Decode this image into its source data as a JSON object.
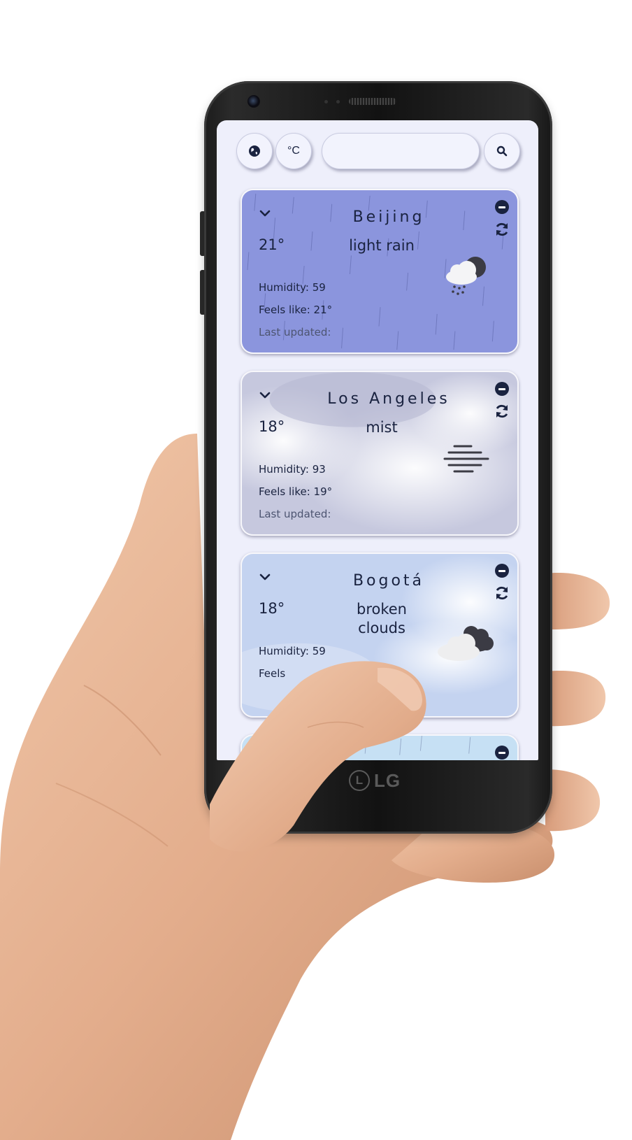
{
  "toolbar": {
    "location_button_label": "",
    "unit_button_label": "°C",
    "search_value": "",
    "search_placeholder": ""
  },
  "cards": [
    {
      "city": "Beijing",
      "temperature": "21°",
      "description": "light rain",
      "humidity": "Humidity: 59",
      "feels_like": "Feels like: 21°",
      "last_updated": "Last updated:",
      "icon": "rain-cloud-moon-icon",
      "background": "rain"
    },
    {
      "city": "Los Angeles",
      "temperature": "18°",
      "description": "mist",
      "humidity": "Humidity: 93",
      "feels_like": "Feels like: 19°",
      "last_updated": "Last updated:",
      "icon": "mist-icon",
      "background": "mist"
    },
    {
      "city": "Bogotá",
      "temperature": "18°",
      "description": "broken clouds",
      "description_lines": [
        "broken",
        "clouds"
      ],
      "humidity": "Humidity: 59",
      "feels_like": "Feels",
      "last_updated": "",
      "icon": "broken-clouds-icon",
      "background": "clouds"
    }
  ],
  "device": {
    "brand": "LG"
  },
  "colors": {
    "screen_bg": "#eeeffb",
    "text_primary": "#1a2340",
    "rain_card": "#8b95dd",
    "mist_card": "#c6c8de",
    "clouds_card": "#c4d3f0"
  }
}
